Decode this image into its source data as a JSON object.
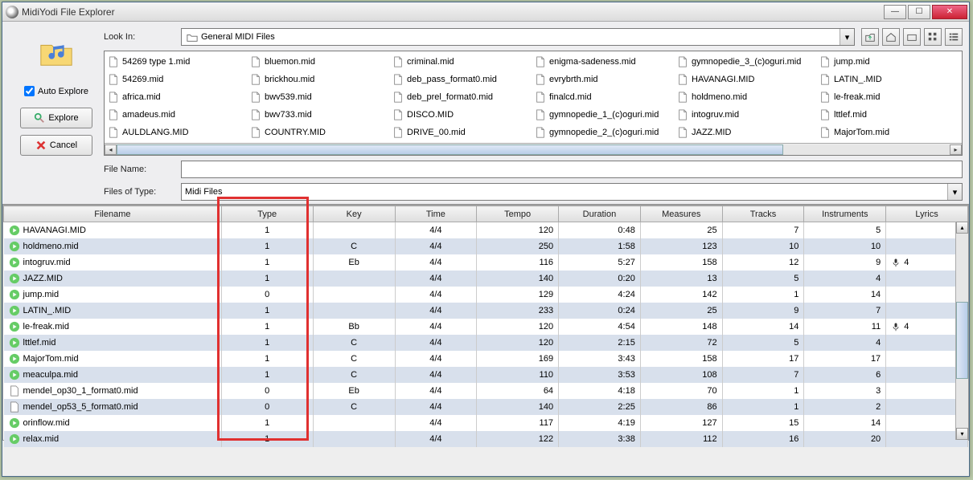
{
  "window": {
    "title": "MidiYodi File Explorer"
  },
  "sidebar": {
    "auto_explore_label": "Auto Explore",
    "explore_label": "Explore",
    "cancel_label": "Cancel"
  },
  "lookin": {
    "label": "Look In:",
    "value": "General MIDI Files"
  },
  "files": [
    "54269 type 1.mid",
    "54269.mid",
    "africa.mid",
    "amadeus.mid",
    "AULDLANG.MID",
    "bluemon.mid",
    "brickhou.mid",
    "bwv539.mid",
    "bwv733.mid",
    "COUNTRY.MID",
    "criminal.mid",
    "deb_pass_format0.mid",
    "deb_prel_format0.mid",
    "DISCO.MID",
    "DRIVE_00.mid",
    "enigma-sadeness.mid",
    "evrybrth.mid",
    "finalcd.mid",
    "gymnopedie_1_(c)oguri.mid",
    "gymnopedie_2_(c)oguri.mid",
    "gymnopedie_3_(c)oguri.mid",
    "HAVANAGI.MID",
    "holdmeno.mid",
    "intogruv.mid",
    "JAZZ.MID",
    "jump.mid",
    "LATIN_.MID",
    "le-freak.mid",
    "lttlef.mid",
    "MajorTom.mid"
  ],
  "filename": {
    "label": "File Name:",
    "value": ""
  },
  "filetype": {
    "label": "Files of Type:",
    "value": "Midi Files"
  },
  "columns": [
    "Filename",
    "Type",
    "Key",
    "Time",
    "Tempo",
    "Duration",
    "Measures",
    "Tracks",
    "Instruments",
    "Lyrics"
  ],
  "rows": [
    {
      "fn": "HAVANAGI.MID",
      "type": "1",
      "key": "",
      "time": "4/4",
      "tempo": "120",
      "dur": "0:48",
      "meas": "25",
      "trk": "7",
      "instr": "5",
      "lyr": ""
    },
    {
      "fn": "holdmeno.mid",
      "type": "1",
      "key": "C",
      "time": "4/4",
      "tempo": "250",
      "dur": "1:58",
      "meas": "123",
      "trk": "10",
      "instr": "10",
      "lyr": ""
    },
    {
      "fn": "intogruv.mid",
      "type": "1",
      "key": "Eb",
      "time": "4/4",
      "tempo": "116",
      "dur": "5:27",
      "meas": "158",
      "trk": "12",
      "instr": "9",
      "lyr": "4"
    },
    {
      "fn": "JAZZ.MID",
      "type": "1",
      "key": "",
      "time": "4/4",
      "tempo": "140",
      "dur": "0:20",
      "meas": "13",
      "trk": "5",
      "instr": "4",
      "lyr": ""
    },
    {
      "fn": "jump.mid",
      "type": "0",
      "key": "",
      "time": "4/4",
      "tempo": "129",
      "dur": "4:24",
      "meas": "142",
      "trk": "1",
      "instr": "14",
      "lyr": ""
    },
    {
      "fn": "LATIN_.MID",
      "type": "1",
      "key": "",
      "time": "4/4",
      "tempo": "233",
      "dur": "0:24",
      "meas": "25",
      "trk": "9",
      "instr": "7",
      "lyr": ""
    },
    {
      "fn": "le-freak.mid",
      "type": "1",
      "key": "Bb",
      "time": "4/4",
      "tempo": "120",
      "dur": "4:54",
      "meas": "148",
      "trk": "14",
      "instr": "11",
      "lyr": "4"
    },
    {
      "fn": "lttlef.mid",
      "type": "1",
      "key": "C",
      "time": "4/4",
      "tempo": "120",
      "dur": "2:15",
      "meas": "72",
      "trk": "5",
      "instr": "4",
      "lyr": ""
    },
    {
      "fn": "MajorTom.mid",
      "type": "1",
      "key": "C",
      "time": "4/4",
      "tempo": "169",
      "dur": "3:43",
      "meas": "158",
      "trk": "17",
      "instr": "17",
      "lyr": ""
    },
    {
      "fn": "meaculpa.mid",
      "type": "1",
      "key": "C",
      "time": "4/4",
      "tempo": "110",
      "dur": "3:53",
      "meas": "108",
      "trk": "7",
      "instr": "6",
      "lyr": ""
    },
    {
      "fn": "mendel_op30_1_format0.mid",
      "type": "0",
      "key": "Eb",
      "time": "4/4",
      "tempo": "64",
      "dur": "4:18",
      "meas": "70",
      "trk": "1",
      "instr": "3",
      "lyr": ""
    },
    {
      "fn": "mendel_op53_5_format0.mid",
      "type": "0",
      "key": "C",
      "time": "4/4",
      "tempo": "140",
      "dur": "2:25",
      "meas": "86",
      "trk": "1",
      "instr": "2",
      "lyr": ""
    },
    {
      "fn": "orinflow.mid",
      "type": "1",
      "key": "",
      "time": "4/4",
      "tempo": "117",
      "dur": "4:19",
      "meas": "127",
      "trk": "15",
      "instr": "14",
      "lyr": ""
    },
    {
      "fn": "relax.mid",
      "type": "1",
      "key": "",
      "time": "4/4",
      "tempo": "122",
      "dur": "3:38",
      "meas": "112",
      "trk": "16",
      "instr": "20",
      "lyr": ""
    }
  ]
}
